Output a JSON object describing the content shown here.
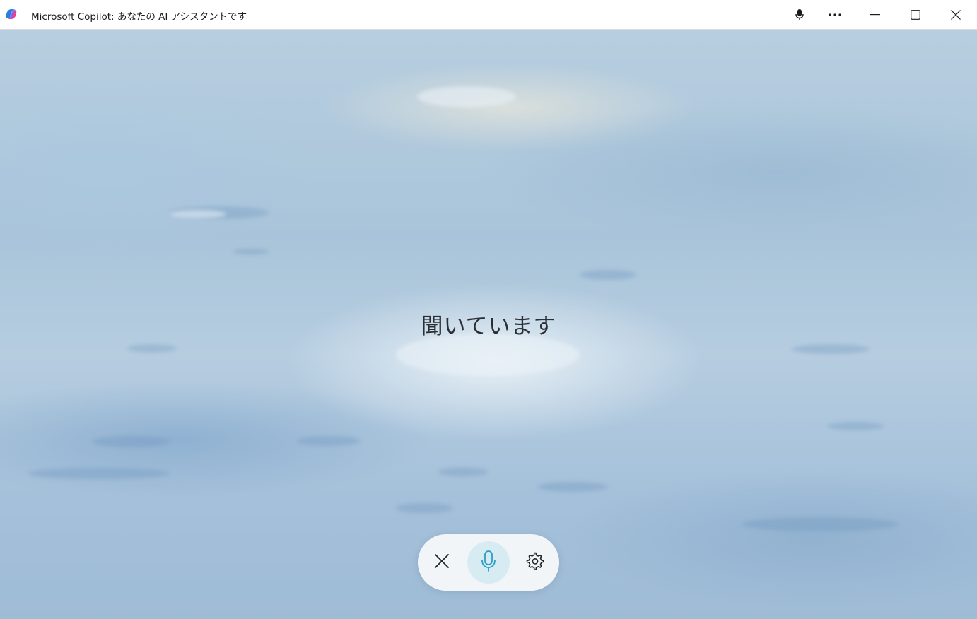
{
  "window": {
    "title": "Microsoft Copilot: あなたの AI アシスタントです"
  },
  "titlebar": {
    "icons": [
      "copilot-logo-icon",
      "microphone-icon",
      "more-options-icon",
      "minimize-icon",
      "maximize-icon",
      "close-icon"
    ]
  },
  "main": {
    "status_text": "聞いています"
  },
  "controls": {
    "icons": [
      "close-icon",
      "microphone-icon",
      "gear-icon"
    ],
    "mic_active_color": "#2a9fc4",
    "mic_bg_color": "#d6ecf2"
  }
}
